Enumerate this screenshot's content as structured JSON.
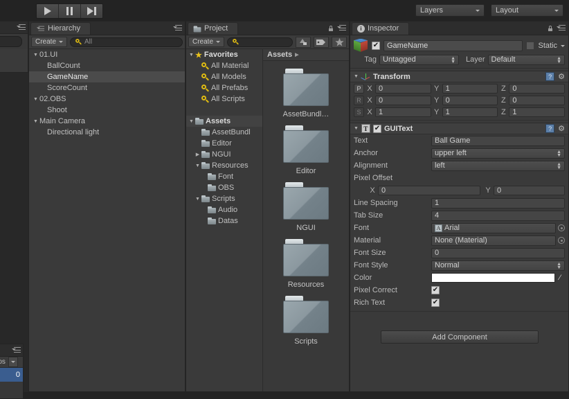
{
  "toolbar": {
    "play_icon": "play-icon",
    "pause_icon": "pause-icon",
    "step_icon": "step-icon",
    "layers_label": "Layers",
    "layout_label": "Layout"
  },
  "edge_panels": {
    "bottom": {
      "tab_label": "mos",
      "value": "0"
    }
  },
  "hierarchy": {
    "tab_title": "Hierarchy",
    "create_label": "Create",
    "search_placeholder": "All",
    "items": [
      {
        "label": "01.UI",
        "depth": 0,
        "arrow": "▼",
        "selected": false
      },
      {
        "label": "BallCount",
        "depth": 1,
        "arrow": "",
        "selected": false
      },
      {
        "label": "GameName",
        "depth": 1,
        "arrow": "",
        "selected": true
      },
      {
        "label": "ScoreCount",
        "depth": 1,
        "arrow": "",
        "selected": false
      },
      {
        "label": "02.OBS",
        "depth": 0,
        "arrow": "▼",
        "selected": false
      },
      {
        "label": "Shoot",
        "depth": 1,
        "arrow": "",
        "selected": false
      },
      {
        "label": "Main Camera",
        "depth": 0,
        "arrow": "▼",
        "selected": false
      },
      {
        "label": "Directional light",
        "depth": 1,
        "arrow": "",
        "selected": false
      }
    ]
  },
  "project": {
    "tab_title": "Project",
    "create_label": "Create",
    "search_placeholder": "",
    "filter_icons": [
      "shapes-filter-icon",
      "label-filter-icon",
      "star-filter-icon"
    ],
    "tree": [
      {
        "label": "Favorites",
        "depth": 0,
        "arrow": "▼",
        "icon": "star-icon",
        "bold": true
      },
      {
        "label": "All Material",
        "depth": 1,
        "arrow": "",
        "icon": "search-icon",
        "bold": false
      },
      {
        "label": "All Models",
        "depth": 1,
        "arrow": "",
        "icon": "search-icon",
        "bold": false
      },
      {
        "label": "All Prefabs",
        "depth": 1,
        "arrow": "",
        "icon": "search-icon",
        "bold": false
      },
      {
        "label": "All Scripts",
        "depth": 1,
        "arrow": "",
        "icon": "search-icon",
        "bold": false
      },
      {
        "label": "",
        "depth": 0,
        "arrow": "",
        "icon": "",
        "bold": false
      },
      {
        "label": "Assets",
        "depth": 0,
        "arrow": "▼",
        "icon": "folder-icon",
        "bold": true,
        "highlighted": true
      },
      {
        "label": "AssetBundl",
        "depth": 1,
        "arrow": "",
        "icon": "folder-icon",
        "bold": false
      },
      {
        "label": "Editor",
        "depth": 1,
        "arrow": "",
        "icon": "folder-icon",
        "bold": false
      },
      {
        "label": "NGUI",
        "depth": 1,
        "arrow": "▶",
        "icon": "folder-icon",
        "bold": false
      },
      {
        "label": "Resources",
        "depth": 1,
        "arrow": "▼",
        "icon": "folder-icon",
        "bold": false
      },
      {
        "label": "Font",
        "depth": 2,
        "arrow": "",
        "icon": "folder-icon",
        "bold": false
      },
      {
        "label": "OBS",
        "depth": 2,
        "arrow": "",
        "icon": "folder-icon",
        "bold": false
      },
      {
        "label": "Scripts",
        "depth": 1,
        "arrow": "▼",
        "icon": "folder-icon",
        "bold": false
      },
      {
        "label": "Audio",
        "depth": 2,
        "arrow": "",
        "icon": "folder-icon",
        "bold": false
      },
      {
        "label": "Datas",
        "depth": 2,
        "arrow": "",
        "icon": "folder-icon",
        "bold": false
      }
    ],
    "breadcrumb": "Assets",
    "grid_items": [
      {
        "label": "AssetBundl…"
      },
      {
        "label": "Editor"
      },
      {
        "label": "NGUI"
      },
      {
        "label": "Resources"
      },
      {
        "label": "Scripts"
      }
    ]
  },
  "inspector": {
    "tab_title": "Inspector",
    "object": {
      "name": "GameName",
      "enabled": true,
      "static_label": "Static",
      "static_checked": false,
      "tag_label": "Tag",
      "tag_value": "Untagged",
      "layer_label": "Layer",
      "layer_value": "Default"
    },
    "transform": {
      "title": "Transform",
      "rows": [
        {
          "key": "P",
          "dim": false,
          "x": "0",
          "y": "1",
          "z": "0"
        },
        {
          "key": "R",
          "dim": true,
          "x": "0",
          "y": "0",
          "z": "0"
        },
        {
          "key": "S",
          "dim": true,
          "x": "1",
          "y": "1",
          "z": "1"
        }
      ]
    },
    "guitext": {
      "title": "GUIText",
      "enabled": true,
      "text_label": "Text",
      "text_value": "Ball Game",
      "anchor_label": "Anchor",
      "anchor_value": "upper left",
      "alignment_label": "Alignment",
      "alignment_value": "left",
      "pixel_offset_label": "Pixel Offset",
      "pixel_offset_x": "0",
      "pixel_offset_y": "0",
      "line_spacing_label": "Line Spacing",
      "line_spacing_value": "1",
      "tab_size_label": "Tab Size",
      "tab_size_value": "4",
      "font_label": "Font",
      "font_value": "Arial",
      "material_label": "Material",
      "material_value": "None (Material)",
      "font_size_label": "Font Size",
      "font_size_value": "0",
      "font_style_label": "Font Style",
      "font_style_value": "Normal",
      "color_label": "Color",
      "color_value": "#ffffff",
      "pixel_correct_label": "Pixel Correct",
      "pixel_correct_checked": true,
      "rich_text_label": "Rich Text",
      "rich_text_checked": true
    },
    "add_component_label": "Add Component"
  }
}
